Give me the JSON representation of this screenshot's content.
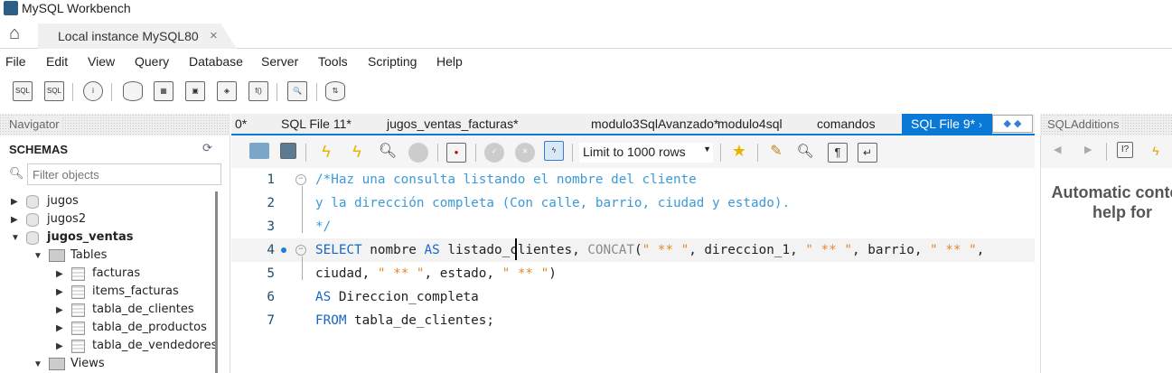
{
  "window": {
    "title": "MySQL Workbench"
  },
  "connection_tab": {
    "label": "Local instance MySQL80",
    "close": "×"
  },
  "menu": [
    "File",
    "Edit",
    "View",
    "Query",
    "Database",
    "Server",
    "Tools",
    "Scripting",
    "Help"
  ],
  "navigator": {
    "header": "Navigator",
    "schemas_label": "SCHEMAS",
    "filter_placeholder": "Filter objects",
    "tree": [
      {
        "label": "jugos",
        "type": "db",
        "expanded": false
      },
      {
        "label": "jugos2",
        "type": "db",
        "expanded": false
      },
      {
        "label": "jugos_ventas",
        "type": "db",
        "expanded": true,
        "bold": true
      },
      {
        "label": "Tables",
        "type": "folder",
        "expanded": true
      },
      {
        "label": "facturas",
        "type": "table"
      },
      {
        "label": "items_facturas",
        "type": "table"
      },
      {
        "label": "tabla_de_clientes",
        "type": "table"
      },
      {
        "label": "tabla_de_productos",
        "type": "table"
      },
      {
        "label": "tabla_de_vendedores",
        "type": "table"
      },
      {
        "label": "Views",
        "type": "folder",
        "expanded": true
      }
    ]
  },
  "editor_tabs": [
    "0*",
    "SQL File 11*",
    "jugos_ventas_facturas*",
    "modulo3SqlAvanzado*",
    "modulo4sql",
    "comandos"
  ],
  "active_tab": "SQL File 9*",
  "limit_select": "Limit to 1000 rows",
  "code": [
    {
      "n": "1",
      "tokens": [
        [
          "/*Haz una consulta listando el nombre del cliente",
          "comment"
        ]
      ]
    },
    {
      "n": "2",
      "tokens": [
        [
          "y la dirección completa (Con calle, barrio, ciudad y estado).",
          "comment"
        ]
      ]
    },
    {
      "n": "3",
      "tokens": [
        [
          "*/",
          "comment"
        ]
      ]
    },
    {
      "n": "4",
      "tokens": [
        [
          "SELECT",
          "kw"
        ],
        [
          " nombre ",
          "txt"
        ],
        [
          "AS",
          "kw"
        ],
        [
          " listado_clientes, ",
          "txt"
        ],
        [
          "CONCAT",
          "fn"
        ],
        [
          "(",
          "txt"
        ],
        [
          "\" ** \"",
          "str"
        ],
        [
          ", direccion_1, ",
          "txt"
        ],
        [
          "\" ** \"",
          "str"
        ],
        [
          ", barrio, ",
          "txt"
        ],
        [
          "\" ** \"",
          "str"
        ],
        [
          ",",
          "txt"
        ]
      ]
    },
    {
      "n": "5",
      "tokens": [
        [
          "ciudad, ",
          "txt"
        ],
        [
          "\" ** \"",
          "str"
        ],
        [
          ", estado, ",
          "txt"
        ],
        [
          "\" ** \"",
          "str"
        ],
        [
          ")",
          "txt"
        ]
      ]
    },
    {
      "n": "6",
      "tokens": [
        [
          "AS",
          "kw"
        ],
        [
          " Direccion_completa",
          "txt"
        ]
      ]
    },
    {
      "n": "7",
      "tokens": [
        [
          "FROM",
          "kw"
        ],
        [
          " tabla_de_clientes;",
          "txt"
        ]
      ]
    }
  ],
  "sql_additions": {
    "header": "SQLAdditions",
    "text": "Automatic context help for"
  }
}
